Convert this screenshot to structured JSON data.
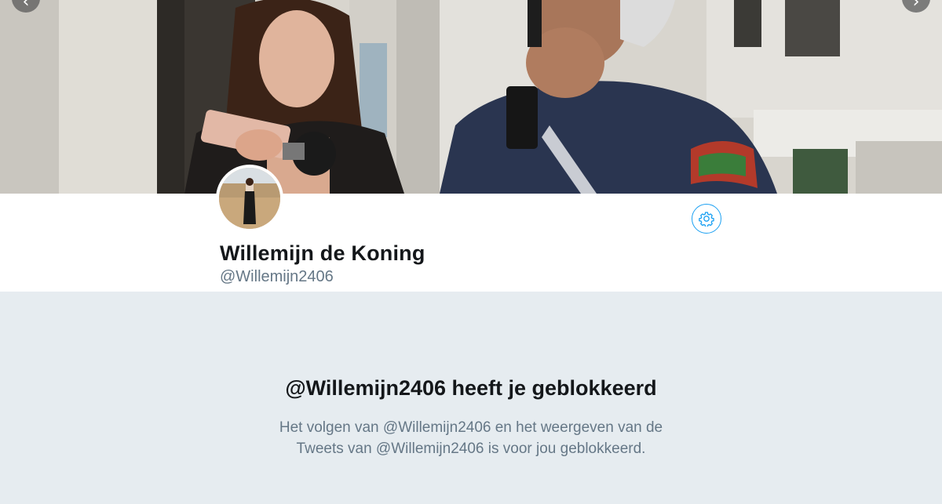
{
  "banner": {
    "prev_arrow": "‹",
    "next_arrow": "›"
  },
  "profile": {
    "name": "Willemijn de Koning",
    "handle": "@Willemijn2406",
    "settings_icon": "gear-icon",
    "accent_color": "#1da1f2"
  },
  "blocked": {
    "title": "@Willemijn2406 heeft je geblokkeerd",
    "line1": "Het volgen van @Willemijn2406 en het weergeven van de",
    "line2": "Tweets van @Willemijn2406 is voor jou geblokkeerd."
  }
}
